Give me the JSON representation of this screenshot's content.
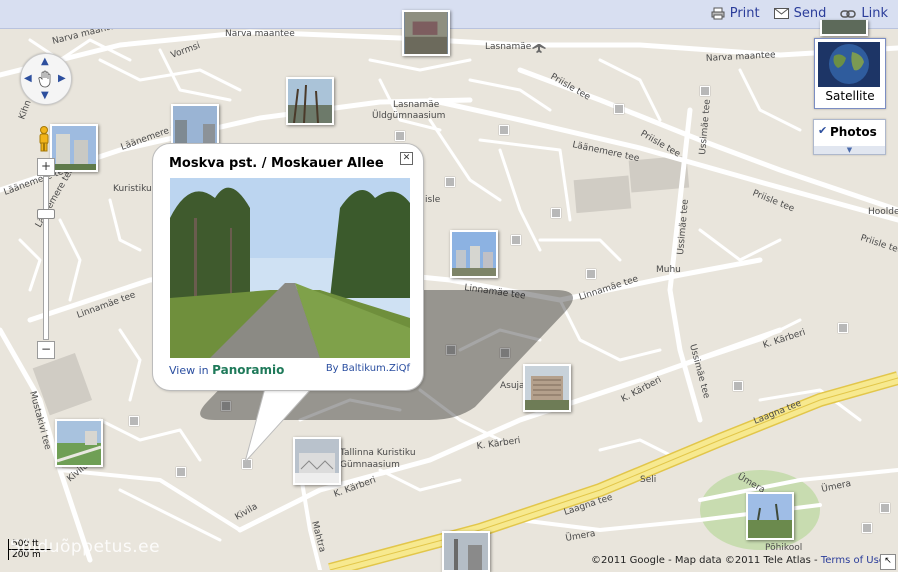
{
  "toolbar": {
    "print_label": "Print",
    "send_label": "Send",
    "link_label": "Link"
  },
  "map_labels": {
    "narva1": "Narva maantee",
    "narva2": "Narva maantee",
    "narva3": "Narva maantee",
    "vormsi": "Vormsi",
    "lasnamae": "Lasnamäe",
    "lasnamae_school": "Lasnamäe",
    "lasnamae_school2": "Üldgümnaasium",
    "priisle1": "Priisle tee",
    "priisle2": "Priisle tee",
    "priisle3": "Priisle tee",
    "priisle4": "Priisle tee",
    "laanemere1": "Läänemere tee",
    "laanemere2": "Läänemere tee",
    "laanemere3": "Läänemere tee",
    "laanemere4": "Läänemere tee",
    "ussimae1": "Ussimäe tee",
    "ussimae2": "Ussimäe tee",
    "ussimae3": "Ussimäe tee",
    "kuristiku": "Kuristiku",
    "linnamae1": "Linnamäe tee",
    "linnamae2": "Linnamäe tee",
    "linnamae3": "Linnamäe tee",
    "muhu": "Muhu",
    "hoolde": "Hoolde",
    "karberi1": "K. Kärberi",
    "karberi2": "K. Kärberi",
    "karberi3": "K. Kärberi",
    "karberi4": "K. Kärberi",
    "karberi5": "K. Kärberi",
    "asuja": "Asuja",
    "school1": "Tallinna Kuristiku",
    "school2": "Gümnaasium",
    "mustakivi": "Mustakivi tee",
    "kivila1": "Kivila",
    "kivila2": "Kivila",
    "mahtra": "Mahtra",
    "laagna1": "Laagna tee",
    "laagna2": "Laagna tee",
    "seli": "Seli",
    "umera1": "Ümera",
    "umera2": "Ümera",
    "umera3": "Ümera",
    "pohikool": "Põhikool",
    "kihn": "Kihn",
    "isle": "isle"
  },
  "controls": {
    "zoom_in": "+",
    "zoom_out": "−",
    "satellite_label": "Satellite",
    "photos_label": "Photos",
    "photos_checked": "✔"
  },
  "popup": {
    "title": "Moskva pst. / Moskauer Allee",
    "view_in": "View in",
    "logo": "Panoramio",
    "author": "By Baltikum.ZiQf"
  },
  "footer": {
    "scale_ft": "500 ft",
    "scale_m": "200 m",
    "watermark": "Sõiduõppetus.ee",
    "copyright": "©2011 Google - Map data ©2011 Tele Atlas -",
    "terms": "Terms of Use"
  },
  "colors": {
    "roads": "#ffffff",
    "background": "#e9e5dc",
    "highway": "#f7e98f",
    "park": "#c8dcb0",
    "link": "#2b3d9a"
  }
}
